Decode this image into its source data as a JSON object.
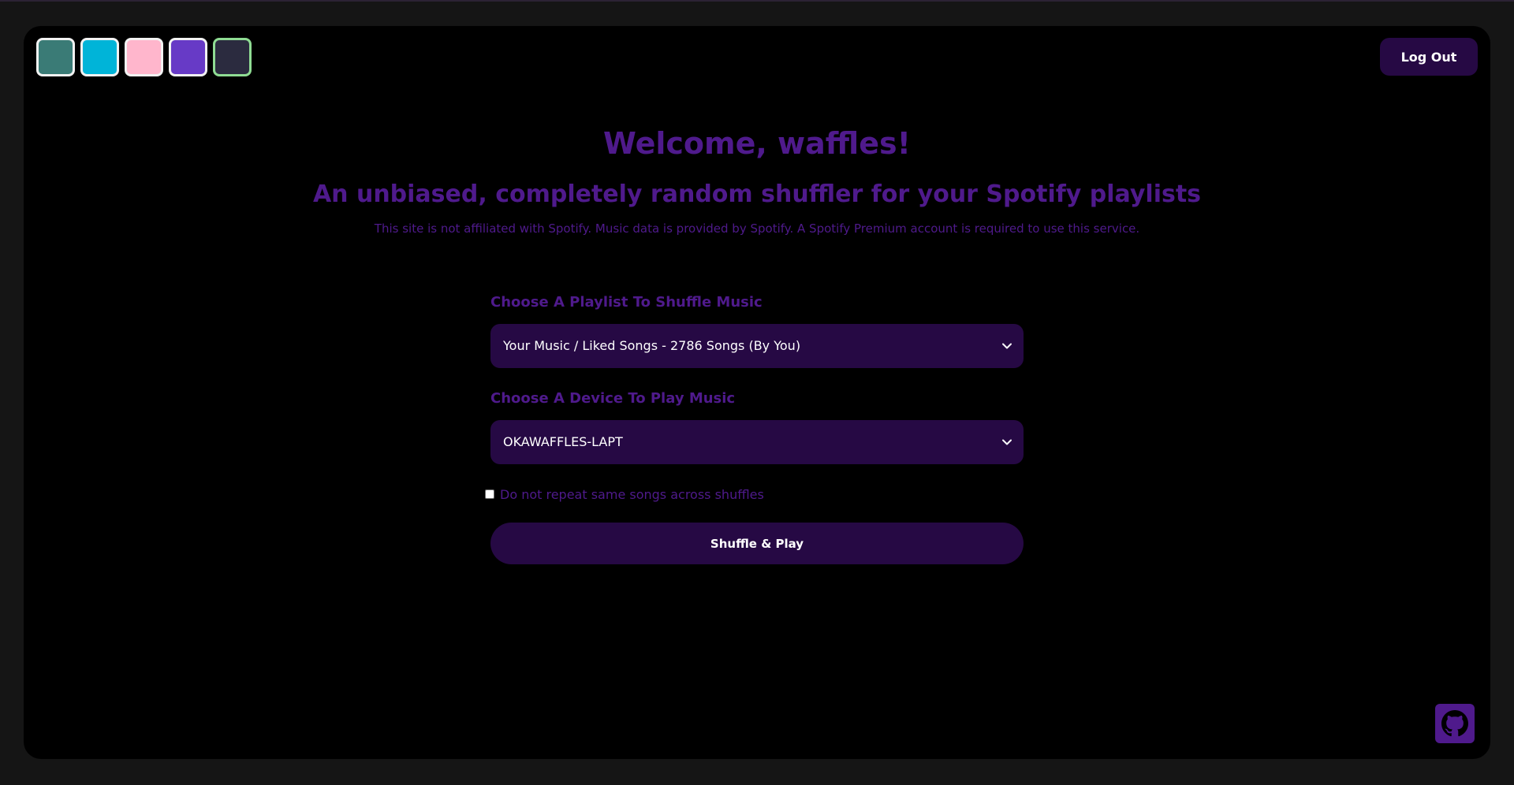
{
  "theme_swatches": [
    {
      "name": "teal",
      "color": "#3a7b76"
    },
    {
      "name": "cyan",
      "color": "#00b4d8"
    },
    {
      "name": "pink",
      "color": "#ffb6cc"
    },
    {
      "name": "purple",
      "color": "#673ac6"
    },
    {
      "name": "dark",
      "color": "#2b2b3f",
      "active": true
    }
  ],
  "header": {
    "logout_label": "Log Out"
  },
  "hero": {
    "welcome": "Welcome, waffles!",
    "subtitle": "An unbiased, completely random shuffler for your Spotify playlists",
    "disclaimer": "This site is not affiliated with Spotify. Music data is provided by Spotify. A Spotify Premium account is required to use this service."
  },
  "form": {
    "playlist_label": "Choose A Playlist To Shuffle Music",
    "playlist_selected": "Your Music / Liked Songs - 2786 Songs (By You)",
    "device_label": "Choose A Device To Play Music",
    "device_selected": "OKAWAFFLES-LAPT",
    "no_repeat_label": "Do not repeat same songs across shuffles",
    "no_repeat_checked": false,
    "shuffle_label": "Shuffle & Play"
  },
  "colors": {
    "accent_text": "#4f1a8c",
    "control_bg": "#260944",
    "panel_bg": "#000000",
    "page_bg": "#151515"
  },
  "icons": {
    "select_chevron": "chevron-down-icon",
    "github": "github-icon"
  }
}
